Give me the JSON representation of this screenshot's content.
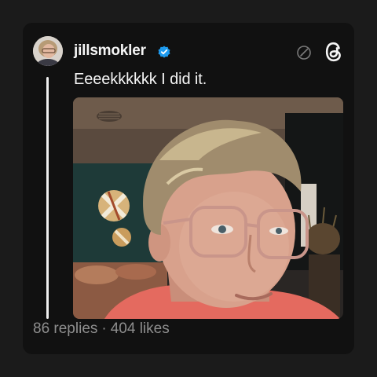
{
  "post": {
    "username": "jillsmokler",
    "verified_icon": "verified-badge-icon",
    "text": "Eeeekkkkkk I did it.",
    "replies": "86 replies",
    "separator": "·",
    "likes": "404 likes"
  },
  "icons": {
    "edit": "edit-disabled-icon",
    "app": "threads-logo-icon"
  },
  "colors": {
    "background": "#1b1b1b",
    "card": "#111111",
    "text": "#f5f5f5",
    "muted": "#8e8e8e",
    "verified": "#1d9bf0"
  }
}
